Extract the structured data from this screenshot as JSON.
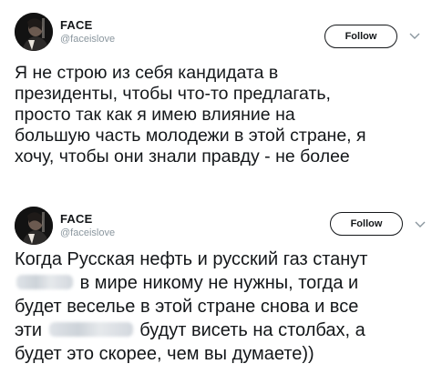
{
  "tweets": [
    {
      "author": {
        "name": "FACE",
        "handle": "@faceislove",
        "avatar": "artist-photo"
      },
      "follow_label": "Follow",
      "menu_icon": "chevron-down-icon",
      "text_lines": [
        "Я не строю из себя кандидата в",
        "президенты, чтобы что-то предлагать,",
        "просто так как я имею влияние на",
        "большую часть молодежи в этой стране, я",
        "хочу, чтобы они знали правду - не более"
      ]
    },
    {
      "author": {
        "name": "FACE",
        "handle": "@faceislove",
        "avatar": "artist-photo"
      },
      "follow_label": "Follow",
      "menu_icon": "chevron-down-icon",
      "text_lines": [
        "Когда Русская нефть и русский газ станут",
        "в мире никому не нужны, тогда и",
        "будет веселье в этой стране снова и все",
        "эти",
        "будут висеть на столбах, а",
        "будет это скорее, чем вы думаете))"
      ]
    }
  ],
  "colors": {
    "text": "#14171a",
    "handle": "#8a969e",
    "censor_blur": "#d3d8de"
  }
}
